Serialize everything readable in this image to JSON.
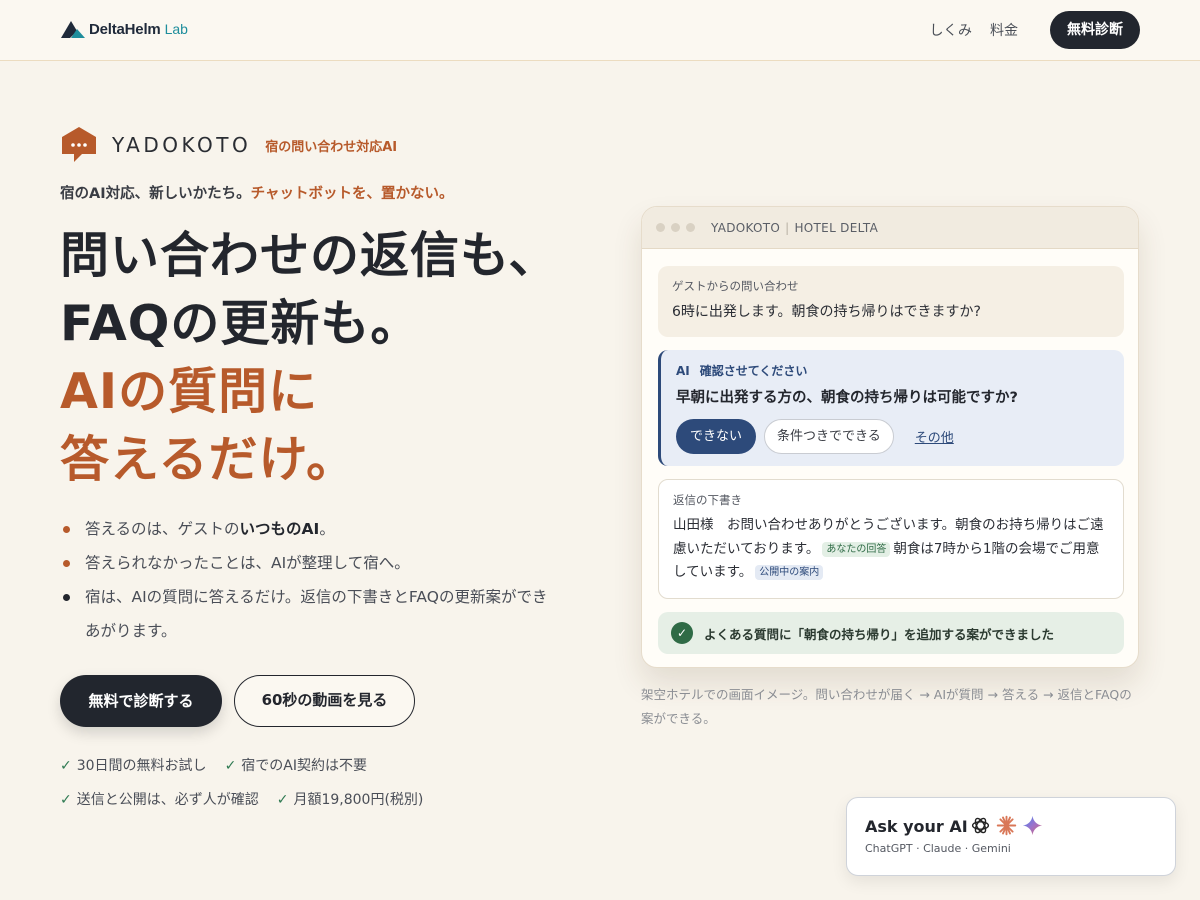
{
  "header": {
    "logo_text": "DeltaHelm",
    "logo_sub": "Lab",
    "nav": [
      "しくみ",
      "料金"
    ],
    "cta": "無料診断"
  },
  "brand": {
    "name": "YADOKOTO",
    "tag": "宿の問い合わせ対応AI"
  },
  "tagline": {
    "main": "宿のAI対応、新しいかたち。",
    "accent": "チャットボットを、置かない。"
  },
  "hero": {
    "line1": "問い合わせの返信も、",
    "line2": "FAQの更新も。",
    "line3": "AIの質問に",
    "line4": "答えるだけ。"
  },
  "bullets": [
    {
      "pre": "答えるのは、ゲストの",
      "bold": "いつものAI",
      "post": "。"
    },
    {
      "text": "答えられなかったことは、AIが整理して宿へ。"
    },
    {
      "text": "宿は、AIの質問に答えるだけ。返信の下書きとFAQの更新案ができあがります。"
    }
  ],
  "buttons": {
    "primary": "無料で診断する",
    "secondary": "60秒の動画を見る"
  },
  "checks": [
    "30日間の無料お試し",
    "宿でのAI契約は不要",
    "送信と公開は、必ず人が確認",
    "月額19,800円(税別)"
  ],
  "mockup": {
    "title_app": "YADOKOTO",
    "title_hotel": "HOTEL DELTA",
    "guest_label": "ゲストからの問い合わせ",
    "guest_msg": "6時に出発します。朝食の持ち帰りはできますか?",
    "ai_label": "AI",
    "ai_status": "確認させてください",
    "ai_question": "早朝に出発する方の、朝食の持ち帰りは可能ですか?",
    "options": [
      "できない",
      "条件つきでできる",
      "その他"
    ],
    "draft_label": "返信の下書き",
    "draft_part1": "山田様　お問い合わせありがとうございます。朝食のお持ち帰りはご遠慮いただいております。",
    "draft_tag1": "あなたの回答",
    "draft_part2": "朝食は7時から1階の会場でご用意しています。",
    "draft_tag2": "公開中の案内",
    "done_text": "よくある質問に「朝食の持ち帰り」を追加する案ができました"
  },
  "caption": "架空ホテルでの画面イメージ。問い合わせが届く → AIが質問 → 答える → 返信とFAQの案ができる。",
  "ask": {
    "title": "Ask your AI",
    "sub": "ChatGPT · Claude · Gemini",
    "icons": [
      "chatgpt-icon",
      "claude-icon",
      "gemini-icon"
    ]
  },
  "colors": {
    "accent": "#b75a2b",
    "dark": "#22262e",
    "navy": "#2d4a7a",
    "green": "#2f6b46",
    "background": "#f8f4ec"
  }
}
